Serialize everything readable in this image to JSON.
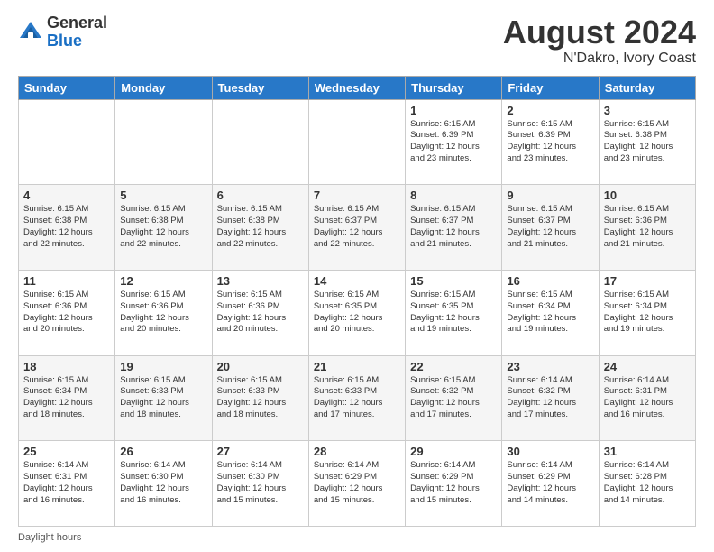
{
  "header": {
    "logo_general": "General",
    "logo_blue": "Blue",
    "month_year": "August 2024",
    "location": "N'Dakro, Ivory Coast"
  },
  "footer": {
    "daylight_label": "Daylight hours"
  },
  "days_of_week": [
    "Sunday",
    "Monday",
    "Tuesday",
    "Wednesday",
    "Thursday",
    "Friday",
    "Saturday"
  ],
  "weeks": [
    [
      {
        "num": "",
        "detail": ""
      },
      {
        "num": "",
        "detail": ""
      },
      {
        "num": "",
        "detail": ""
      },
      {
        "num": "",
        "detail": ""
      },
      {
        "num": "1",
        "detail": "Sunrise: 6:15 AM\nSunset: 6:39 PM\nDaylight: 12 hours\nand 23 minutes."
      },
      {
        "num": "2",
        "detail": "Sunrise: 6:15 AM\nSunset: 6:39 PM\nDaylight: 12 hours\nand 23 minutes."
      },
      {
        "num": "3",
        "detail": "Sunrise: 6:15 AM\nSunset: 6:38 PM\nDaylight: 12 hours\nand 23 minutes."
      }
    ],
    [
      {
        "num": "4",
        "detail": "Sunrise: 6:15 AM\nSunset: 6:38 PM\nDaylight: 12 hours\nand 22 minutes."
      },
      {
        "num": "5",
        "detail": "Sunrise: 6:15 AM\nSunset: 6:38 PM\nDaylight: 12 hours\nand 22 minutes."
      },
      {
        "num": "6",
        "detail": "Sunrise: 6:15 AM\nSunset: 6:38 PM\nDaylight: 12 hours\nand 22 minutes."
      },
      {
        "num": "7",
        "detail": "Sunrise: 6:15 AM\nSunset: 6:37 PM\nDaylight: 12 hours\nand 22 minutes."
      },
      {
        "num": "8",
        "detail": "Sunrise: 6:15 AM\nSunset: 6:37 PM\nDaylight: 12 hours\nand 21 minutes."
      },
      {
        "num": "9",
        "detail": "Sunrise: 6:15 AM\nSunset: 6:37 PM\nDaylight: 12 hours\nand 21 minutes."
      },
      {
        "num": "10",
        "detail": "Sunrise: 6:15 AM\nSunset: 6:36 PM\nDaylight: 12 hours\nand 21 minutes."
      }
    ],
    [
      {
        "num": "11",
        "detail": "Sunrise: 6:15 AM\nSunset: 6:36 PM\nDaylight: 12 hours\nand 20 minutes."
      },
      {
        "num": "12",
        "detail": "Sunrise: 6:15 AM\nSunset: 6:36 PM\nDaylight: 12 hours\nand 20 minutes."
      },
      {
        "num": "13",
        "detail": "Sunrise: 6:15 AM\nSunset: 6:36 PM\nDaylight: 12 hours\nand 20 minutes."
      },
      {
        "num": "14",
        "detail": "Sunrise: 6:15 AM\nSunset: 6:35 PM\nDaylight: 12 hours\nand 20 minutes."
      },
      {
        "num": "15",
        "detail": "Sunrise: 6:15 AM\nSunset: 6:35 PM\nDaylight: 12 hours\nand 19 minutes."
      },
      {
        "num": "16",
        "detail": "Sunrise: 6:15 AM\nSunset: 6:34 PM\nDaylight: 12 hours\nand 19 minutes."
      },
      {
        "num": "17",
        "detail": "Sunrise: 6:15 AM\nSunset: 6:34 PM\nDaylight: 12 hours\nand 19 minutes."
      }
    ],
    [
      {
        "num": "18",
        "detail": "Sunrise: 6:15 AM\nSunset: 6:34 PM\nDaylight: 12 hours\nand 18 minutes."
      },
      {
        "num": "19",
        "detail": "Sunrise: 6:15 AM\nSunset: 6:33 PM\nDaylight: 12 hours\nand 18 minutes."
      },
      {
        "num": "20",
        "detail": "Sunrise: 6:15 AM\nSunset: 6:33 PM\nDaylight: 12 hours\nand 18 minutes."
      },
      {
        "num": "21",
        "detail": "Sunrise: 6:15 AM\nSunset: 6:33 PM\nDaylight: 12 hours\nand 17 minutes."
      },
      {
        "num": "22",
        "detail": "Sunrise: 6:15 AM\nSunset: 6:32 PM\nDaylight: 12 hours\nand 17 minutes."
      },
      {
        "num": "23",
        "detail": "Sunrise: 6:14 AM\nSunset: 6:32 PM\nDaylight: 12 hours\nand 17 minutes."
      },
      {
        "num": "24",
        "detail": "Sunrise: 6:14 AM\nSunset: 6:31 PM\nDaylight: 12 hours\nand 16 minutes."
      }
    ],
    [
      {
        "num": "25",
        "detail": "Sunrise: 6:14 AM\nSunset: 6:31 PM\nDaylight: 12 hours\nand 16 minutes."
      },
      {
        "num": "26",
        "detail": "Sunrise: 6:14 AM\nSunset: 6:30 PM\nDaylight: 12 hours\nand 16 minutes."
      },
      {
        "num": "27",
        "detail": "Sunrise: 6:14 AM\nSunset: 6:30 PM\nDaylight: 12 hours\nand 15 minutes."
      },
      {
        "num": "28",
        "detail": "Sunrise: 6:14 AM\nSunset: 6:29 PM\nDaylight: 12 hours\nand 15 minutes."
      },
      {
        "num": "29",
        "detail": "Sunrise: 6:14 AM\nSunset: 6:29 PM\nDaylight: 12 hours\nand 15 minutes."
      },
      {
        "num": "30",
        "detail": "Sunrise: 6:14 AM\nSunset: 6:29 PM\nDaylight: 12 hours\nand 14 minutes."
      },
      {
        "num": "31",
        "detail": "Sunrise: 6:14 AM\nSunset: 6:28 PM\nDaylight: 12 hours\nand 14 minutes."
      }
    ]
  ]
}
